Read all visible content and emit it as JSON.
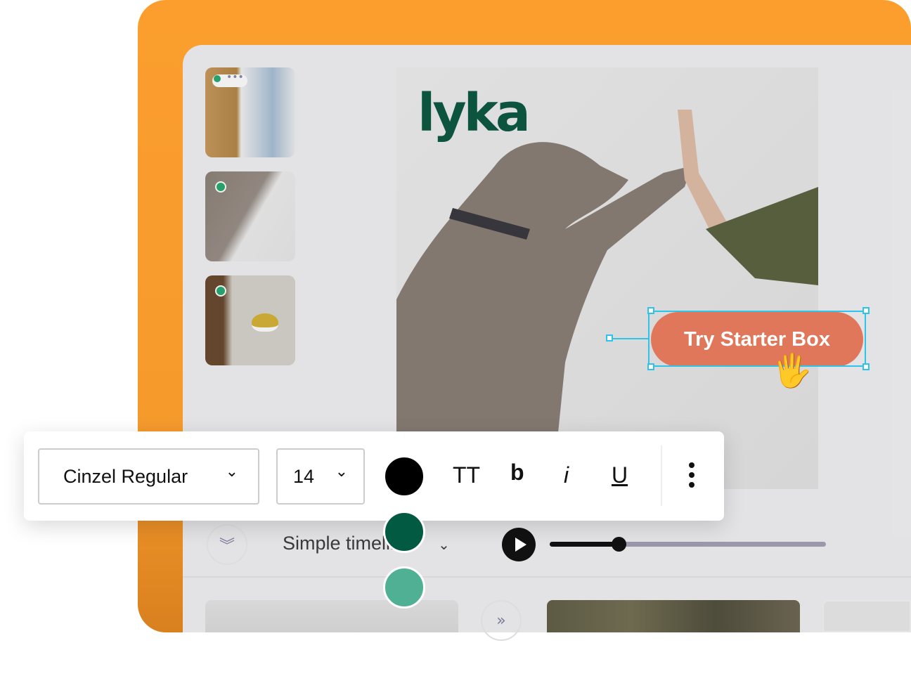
{
  "canvas": {
    "logo_text": "lyka",
    "cta_label": "Try Starter Box"
  },
  "thumbnails": [
    {
      "name": "dog-on-leash"
    },
    {
      "name": "dog-high-five"
    },
    {
      "name": "dog-food-bowl"
    }
  ],
  "toolbar": {
    "font_family": "Cinzel Regular",
    "font_size": "14",
    "text_case_label": "TT",
    "bold_label": "b",
    "italic_label": "i",
    "underline_label": "U",
    "colors": [
      "#000000",
      "#035a43",
      "#4fb094"
    ]
  },
  "timeline": {
    "mode_label": "Simple timeline",
    "progress_percent": 25
  },
  "colors": {
    "brand_orange": "#fb9e2e",
    "cta": "#e1775a",
    "selection": "#2ec4ea",
    "logo": "#0e5a42"
  }
}
